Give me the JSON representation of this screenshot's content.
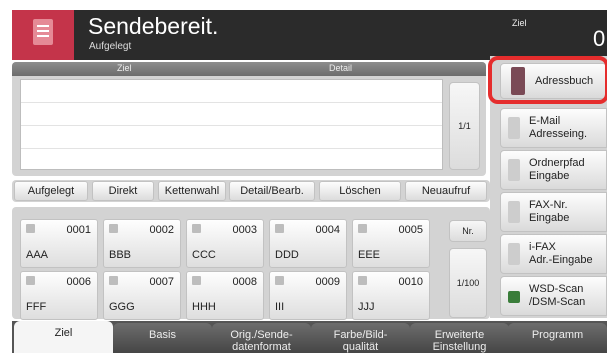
{
  "header": {
    "title": "Sendebereit.",
    "subtitle": "Aufgelegt",
    "dest_label": "Ziel",
    "dest_count": "0"
  },
  "list": {
    "col_ziel": "Ziel",
    "col_detail": "Detail",
    "page": "1/1"
  },
  "actions": [
    "Aufgelegt",
    "Direkt",
    "Kettenwahl",
    "Detail/Bearb.",
    "Löschen",
    "Neuaufruf"
  ],
  "keys": [
    {
      "num": "0001",
      "name": "AAA"
    },
    {
      "num": "0002",
      "name": "BBB"
    },
    {
      "num": "0003",
      "name": "CCC"
    },
    {
      "num": "0004",
      "name": "DDD"
    },
    {
      "num": "0005",
      "name": "EEE"
    },
    {
      "num": "0006",
      "name": "FFF"
    },
    {
      "num": "0007",
      "name": "GGG"
    },
    {
      "num": "0008",
      "name": "HHH"
    },
    {
      "num": "0009",
      "name": "III"
    },
    {
      "num": "0010",
      "name": "JJJ"
    }
  ],
  "side": {
    "nr": "Nr.",
    "page": "1/100"
  },
  "right_menu": {
    "address_book": "Adressbuch",
    "email": [
      "E-Mail",
      "Adresseing."
    ],
    "folder": [
      "Ordnerpfad",
      "Eingabe"
    ],
    "fax": [
      "FAX-Nr.",
      "Eingabe"
    ],
    "ifax": [
      "i-FAX",
      "Adr.-Eingabe"
    ],
    "wsd": [
      "WSD-Scan",
      "/DSM-Scan"
    ]
  },
  "tabs": [
    [
      "Ziel"
    ],
    [
      "Basis"
    ],
    [
      "Orig./Sende-",
      "datenformat"
    ],
    [
      "Farbe/Bild-",
      "qualität"
    ],
    [
      "Erweiterte",
      "Einstellung"
    ],
    [
      "Programm"
    ]
  ],
  "colors": {
    "accent": "#c4344a",
    "highlight": "#e52d2d"
  }
}
